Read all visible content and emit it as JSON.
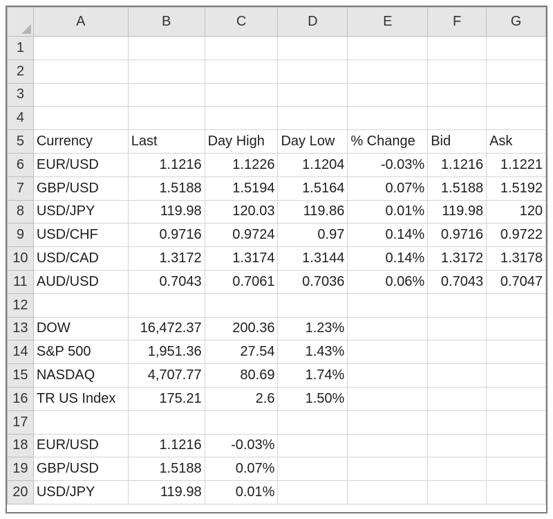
{
  "columns": [
    "A",
    "B",
    "C",
    "D",
    "E",
    "F",
    "G"
  ],
  "rows": [
    {
      "n": "1",
      "cells": [
        "",
        "",
        "",
        "",
        "",
        "",
        ""
      ]
    },
    {
      "n": "2",
      "cells": [
        "",
        "",
        "",
        "",
        "",
        "",
        ""
      ]
    },
    {
      "n": "3",
      "cells": [
        "",
        "",
        "",
        "",
        "",
        "",
        ""
      ]
    },
    {
      "n": "4",
      "cells": [
        "",
        "",
        "",
        "",
        "",
        "",
        ""
      ]
    },
    {
      "n": "5",
      "cells": [
        "Currency",
        "Last",
        "Day High",
        "Day Low",
        "% Change",
        "Bid",
        "Ask"
      ]
    },
    {
      "n": "6",
      "cells": [
        "EUR/USD",
        "1.1216",
        "1.1226",
        "1.1204",
        "-0.03%",
        "1.1216",
        "1.1221"
      ]
    },
    {
      "n": "7",
      "cells": [
        "GBP/USD",
        "1.5188",
        "1.5194",
        "1.5164",
        "0.07%",
        "1.5188",
        "1.5192"
      ]
    },
    {
      "n": "8",
      "cells": [
        "USD/JPY",
        "119.98",
        "120.03",
        "119.86",
        "0.01%",
        "119.98",
        "120"
      ]
    },
    {
      "n": "9",
      "cells": [
        "USD/CHF",
        "0.9716",
        "0.9724",
        "0.97",
        "0.14%",
        "0.9716",
        "0.9722"
      ]
    },
    {
      "n": "10",
      "cells": [
        "USD/CAD",
        "1.3172",
        "1.3174",
        "1.3144",
        "0.14%",
        "1.3172",
        "1.3178"
      ]
    },
    {
      "n": "11",
      "cells": [
        "AUD/USD",
        "0.7043",
        "0.7061",
        "0.7036",
        "0.06%",
        "0.7043",
        "0.7047"
      ]
    },
    {
      "n": "12",
      "cells": [
        "",
        "",
        "",
        "",
        "",
        "",
        ""
      ]
    },
    {
      "n": "13",
      "cells": [
        "DOW",
        "16,472.37",
        "200.36",
        "1.23%",
        "",
        "",
        ""
      ]
    },
    {
      "n": "14",
      "cells": [
        "S&P 500",
        "1,951.36",
        "27.54",
        "1.43%",
        "",
        "",
        ""
      ]
    },
    {
      "n": "15",
      "cells": [
        "NASDAQ",
        "4,707.77",
        "80.69",
        "1.74%",
        "",
        "",
        ""
      ]
    },
    {
      "n": "16",
      "cells": [
        "TR US Index",
        "175.21",
        "2.6",
        "1.50%",
        "",
        "",
        ""
      ]
    },
    {
      "n": "17",
      "cells": [
        "",
        "",
        "",
        "",
        "",
        "",
        ""
      ]
    },
    {
      "n": "18",
      "cells": [
        "EUR/USD",
        "1.1216",
        "-0.03%",
        "",
        "",
        "",
        ""
      ]
    },
    {
      "n": "19",
      "cells": [
        "GBP/USD",
        "1.5188",
        "0.07%",
        "",
        "",
        "",
        ""
      ]
    },
    {
      "n": "20",
      "cells": [
        "USD/JPY",
        "119.98",
        "0.01%",
        "",
        "",
        "",
        ""
      ]
    }
  ]
}
